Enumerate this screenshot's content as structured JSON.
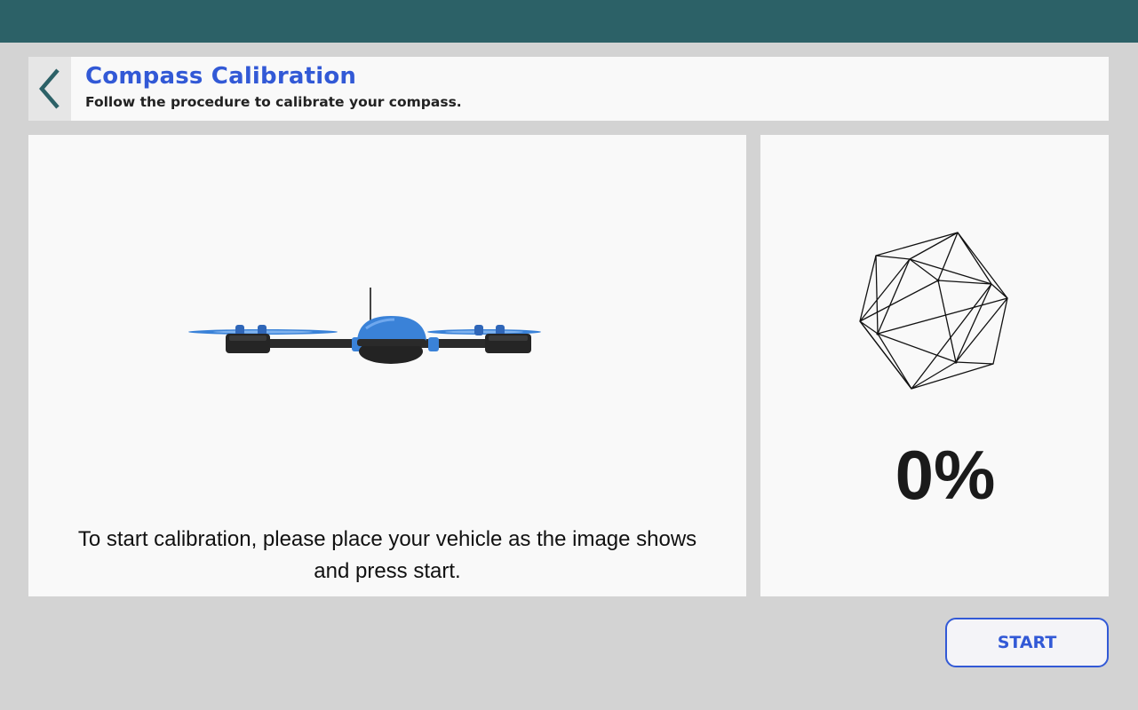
{
  "header": {
    "title": "Compass Calibration",
    "subtitle": "Follow the procedure to calibrate your compass."
  },
  "main": {
    "instruction": "To start calibration, please place your vehicle as the image shows and press start."
  },
  "progress": {
    "value": 0,
    "label": "0%"
  },
  "actions": {
    "start_label": "START"
  },
  "icons": {
    "back": "chevron-left-icon",
    "vehicle": "drone-image",
    "sphere": "icosahedron-wireframe"
  },
  "colors": {
    "topbar": "#2c6167",
    "accent": "#3259d6",
    "drone_blue": "#3a82d8"
  }
}
